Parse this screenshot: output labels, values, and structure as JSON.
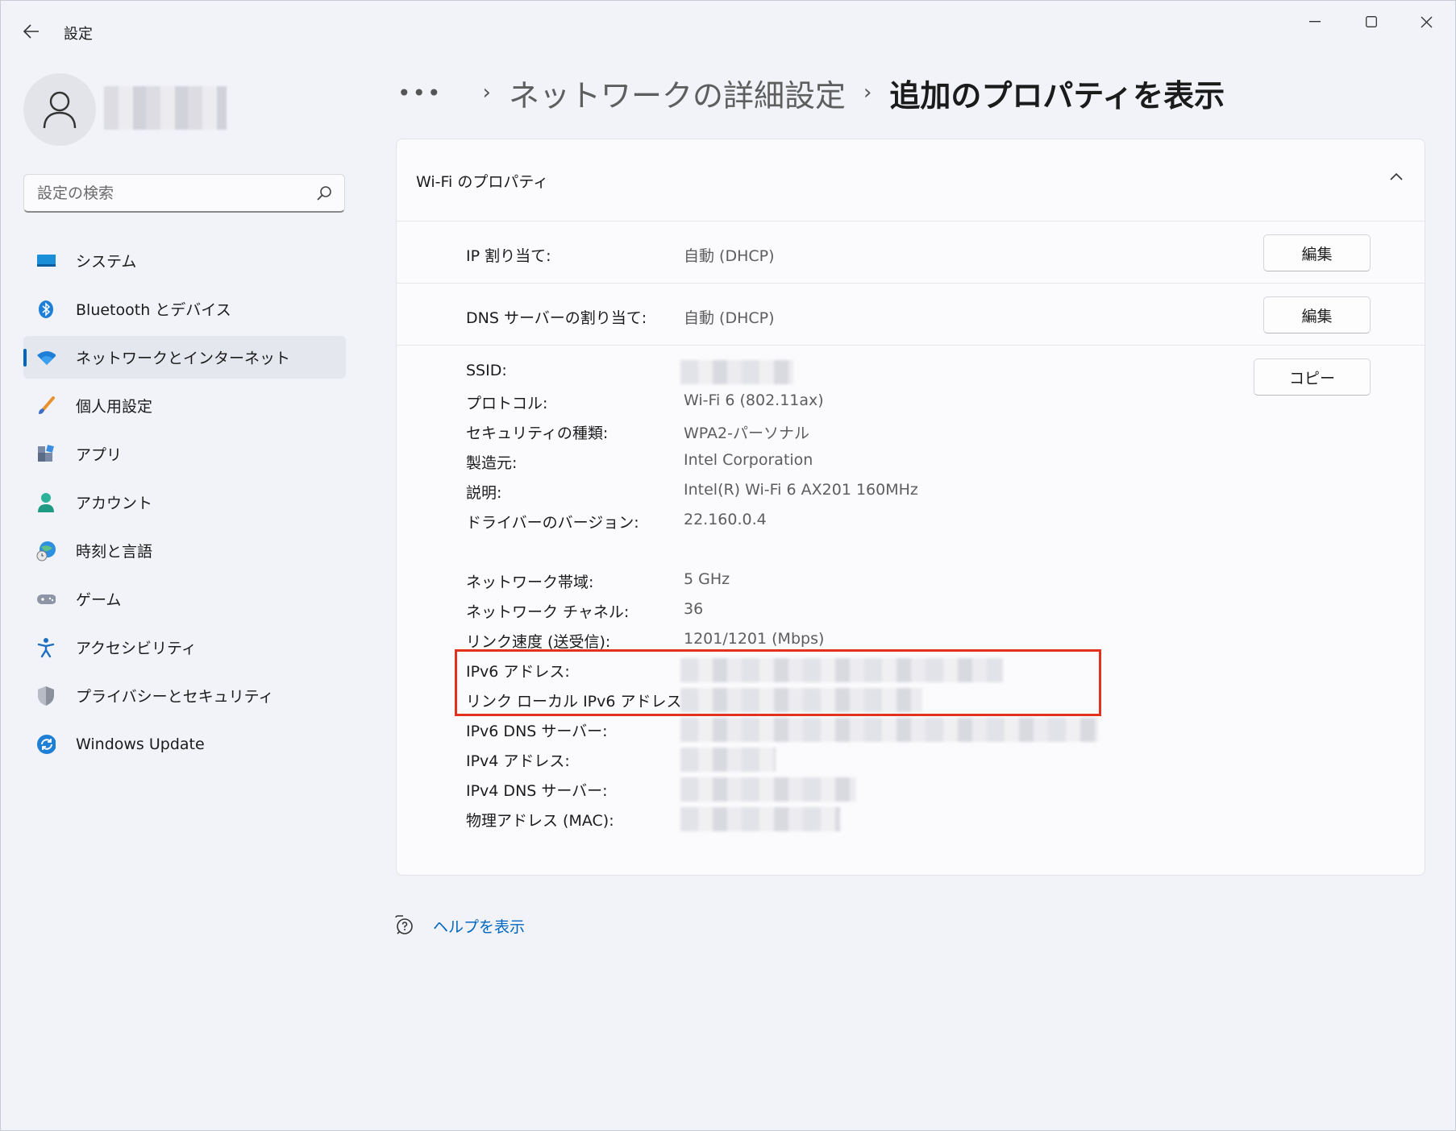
{
  "app": {
    "title": "設定"
  },
  "search": {
    "placeholder": "設定の検索"
  },
  "sidebar": {
    "items": [
      {
        "label": "システム"
      },
      {
        "label": "Bluetooth とデバイス"
      },
      {
        "label": "ネットワークとインターネット"
      },
      {
        "label": "個人用設定"
      },
      {
        "label": "アプリ"
      },
      {
        "label": "アカウント"
      },
      {
        "label": "時刻と言語"
      },
      {
        "label": "ゲーム"
      },
      {
        "label": "アクセシビリティ"
      },
      {
        "label": "プライバシーとセキュリティ"
      },
      {
        "label": "Windows Update"
      }
    ],
    "active_index": 2
  },
  "breadcrumb": {
    "more": "•••",
    "parent": "ネットワークの詳細設定",
    "current": "追加のプロパティを表示"
  },
  "panel": {
    "title": "Wi-Fi のプロパティ",
    "ip_assign": {
      "label": "IP 割り当て:",
      "value": "自動 (DHCP)",
      "button": "編集"
    },
    "dns_assign": {
      "label": "DNS サーバーの割り当て:",
      "value": "自動 (DHCP)",
      "button": "編集"
    },
    "copy_button": "コピー",
    "props": {
      "ssid": {
        "label": "SSID:"
      },
      "protocol": {
        "label": "プロトコル:",
        "value": "Wi-Fi 6 (802.11ax)"
      },
      "security": {
        "label": "セキュリティの種類:",
        "value": "WPA2-パーソナル"
      },
      "manufacturer": {
        "label": "製造元:",
        "value": "Intel Corporation"
      },
      "description": {
        "label": "説明:",
        "value": "Intel(R) Wi-Fi 6 AX201 160MHz"
      },
      "driver": {
        "label": "ドライバーのバージョン:",
        "value": "22.160.0.4"
      },
      "band": {
        "label": "ネットワーク帯域:",
        "value": "5 GHz"
      },
      "channel": {
        "label": "ネットワーク チャネル:",
        "value": "36"
      },
      "link_speed": {
        "label": "リンク速度 (送受信):",
        "value": "1201/1201 (Mbps)"
      },
      "ipv6": {
        "label": "IPv6 アドレス:"
      },
      "link_local_ipv6": {
        "label": "リンク ローカル IPv6 アドレス:"
      },
      "ipv6_dns": {
        "label": "IPv6 DNS サーバー:"
      },
      "ipv4": {
        "label": "IPv4 アドレス:"
      },
      "ipv4_dns": {
        "label": "IPv4 DNS サーバー:"
      },
      "mac": {
        "label": "物理アドレス (MAC):"
      }
    }
  },
  "help": {
    "label": "ヘルプを表示"
  },
  "colors": {
    "accent": "#0067c0",
    "highlight": "#e0321e"
  }
}
